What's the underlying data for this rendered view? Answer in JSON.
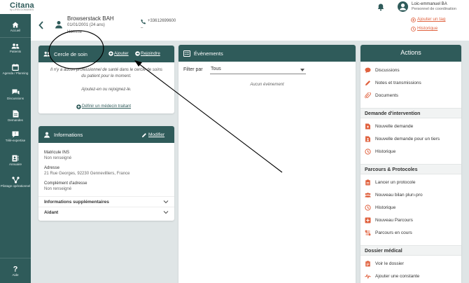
{
  "app": {
    "logo": "Citana",
    "logo_sub": "by LIFEN DOMAINES"
  },
  "user": {
    "name": "Loic-emmanuel BA",
    "role": "Personnel de coordination"
  },
  "sidebar": {
    "items": [
      {
        "label": "Accueil",
        "icon": "home-icon"
      },
      {
        "label": "Patients",
        "icon": "users-icon"
      },
      {
        "label": "Agenda / Planning",
        "icon": "calendar-icon"
      },
      {
        "label": "Discussions",
        "icon": "chat-icon"
      },
      {
        "label": "Demandes",
        "icon": "document-icon"
      },
      {
        "label": "Télé-expertise",
        "icon": "teleexpertise-icon"
      },
      {
        "label": "Annuaire",
        "icon": "directory-icon"
      },
      {
        "label": "Pilotage opérationnel",
        "icon": "network-icon"
      }
    ],
    "help": "Aide"
  },
  "patient": {
    "name": "Browserstack BAH",
    "dob": "01/01/2001 (24 ans)",
    "sex": "Homme",
    "phone": "+33612699600",
    "phone2": "–",
    "add_tag": "Ajouter un tag",
    "history": "Historique"
  },
  "cercle": {
    "title": "Cercle de soin",
    "add": "Ajouter",
    "join": "Rejoindre",
    "message": "Il n'y a aucun professionnel de santé dans le cercle de soins du patient pour le moment.",
    "message2": "Ajoutez-en ou rejoignez-le.",
    "define_doctor": "Définir un médecin traitant"
  },
  "info": {
    "title": "Informations",
    "edit": "Modifier",
    "fields": [
      {
        "label": "Matricule INS",
        "value": "Non renseigné"
      },
      {
        "label": "Adresse",
        "value": "21 Rue Georges, 92230 Gennevilliers, France"
      },
      {
        "label": "Complément d'adresse",
        "value": "Non renseigné"
      }
    ],
    "accordions": [
      "Informations supplémentaires",
      "Aidant"
    ]
  },
  "events": {
    "title": "Évènements",
    "filter_label": "Filter par",
    "filter_value": "Tous",
    "empty": "Aucun évènement"
  },
  "actions": {
    "title": "Actions",
    "top_items": [
      "Discussions",
      "Notes et transmissions",
      "Documents"
    ],
    "sections": [
      {
        "title": "Demande d'intervention",
        "items": [
          "Nouvelle demande",
          "Nouvelle demande pour un tiers",
          "Historique"
        ]
      },
      {
        "title": "Parcours & Protocoles",
        "items": [
          "Lancer un protocole",
          "Nouveau bilan plurı-pro",
          "Historique",
          "Nouveau Parcours",
          "Parcours en cours"
        ]
      },
      {
        "title": "Dossier médical",
        "items": [
          "Voir le dossier",
          "Ajouter une constante"
        ]
      }
    ]
  },
  "colors": {
    "primary": "#2f5b5a",
    "accent": "#e0623f"
  }
}
